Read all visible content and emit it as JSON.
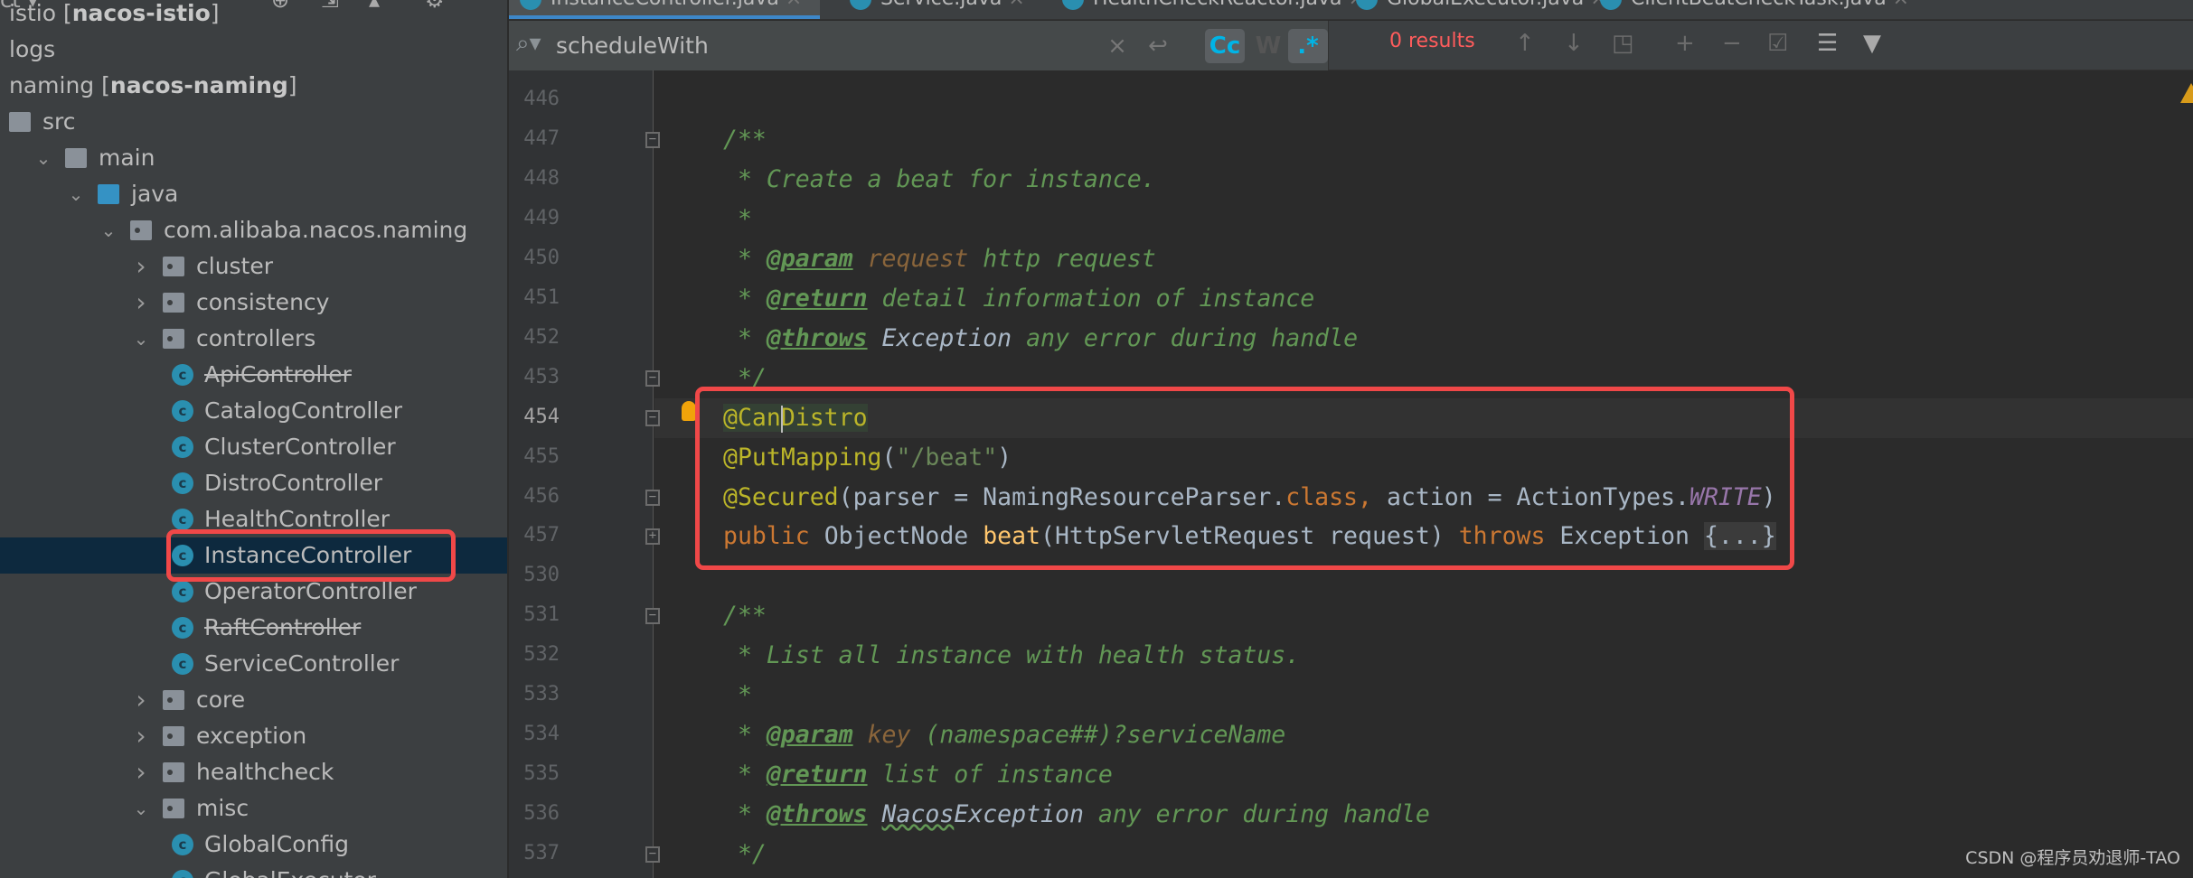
{
  "sidebar": {
    "toolbar_icons": [
      "globe-icon",
      "collapse-all-icon",
      "expand-icon",
      "gear-icon"
    ],
    "items": [
      {
        "label": "nacos-istio",
        "prefix": "istio ",
        "module": "nacos-istio",
        "depth": 0,
        "kind": "module",
        "cut": true
      },
      {
        "label": "logs",
        "depth": 0,
        "kind": "none"
      },
      {
        "label": "naming",
        "module": "nacos-naming",
        "depth": 0,
        "kind": "module"
      },
      {
        "label": "src",
        "depth": 0,
        "kind": "folder"
      },
      {
        "label": "main",
        "depth": 1,
        "kind": "folder",
        "expanded": true
      },
      {
        "label": "java",
        "depth": 2,
        "kind": "folder-blue",
        "expanded": true
      },
      {
        "label": "com.alibaba.nacos.naming",
        "depth": 3,
        "kind": "package",
        "expanded": true
      },
      {
        "label": "cluster",
        "depth": 4,
        "kind": "package",
        "expanded": false
      },
      {
        "label": "consistency",
        "depth": 4,
        "kind": "package",
        "expanded": false
      },
      {
        "label": "controllers",
        "depth": 4,
        "kind": "package",
        "expanded": true
      },
      {
        "label": "ApiController",
        "depth": 5,
        "kind": "class",
        "deprecated": true
      },
      {
        "label": "CatalogController",
        "depth": 5,
        "kind": "class"
      },
      {
        "label": "ClusterController",
        "depth": 5,
        "kind": "class"
      },
      {
        "label": "DistroController",
        "depth": 5,
        "kind": "class"
      },
      {
        "label": "HealthController",
        "depth": 5,
        "kind": "class"
      },
      {
        "label": "InstanceController",
        "depth": 5,
        "kind": "class",
        "selected": true
      },
      {
        "label": "OperatorController",
        "depth": 5,
        "kind": "class"
      },
      {
        "label": "RaftController",
        "depth": 5,
        "kind": "class",
        "deprecated": true
      },
      {
        "label": "ServiceController",
        "depth": 5,
        "kind": "class"
      },
      {
        "label": "core",
        "depth": 4,
        "kind": "package",
        "expanded": false
      },
      {
        "label": "exception",
        "depth": 4,
        "kind": "package",
        "expanded": false
      },
      {
        "label": "healthcheck",
        "depth": 4,
        "kind": "package",
        "expanded": false
      },
      {
        "label": "misc",
        "depth": 4,
        "kind": "package",
        "expanded": true
      },
      {
        "label": "GlobalConfig",
        "depth": 5,
        "kind": "class"
      },
      {
        "label": "GlobalExecutor",
        "depth": 5,
        "kind": "class"
      }
    ]
  },
  "tabs": [
    {
      "label": "InstanceController.java",
      "active": true
    },
    {
      "label": "Service.java"
    },
    {
      "label": "HealthCheckReactor.java"
    },
    {
      "label": "GlobalExecutor.java"
    },
    {
      "label": "ClientBeatCheckTask.java"
    }
  ],
  "search": {
    "value": "scheduleWith",
    "clear_icon": "×",
    "replace_icon": "↩",
    "match_case_label": "Cc",
    "words_label": "W",
    "regex_label": ".*",
    "results": "0 results",
    "results_color": "#ff5c5c"
  },
  "editor": {
    "current_line": "454",
    "lines": [
      {
        "n": "446",
        "tokens": []
      },
      {
        "n": "447",
        "fold": "open",
        "tokens": [
          [
            "/**",
            "c"
          ]
        ]
      },
      {
        "n": "448",
        "tokens": [
          [
            " * Create a beat for instance.",
            "c"
          ]
        ]
      },
      {
        "n": "449",
        "tokens": [
          [
            " *",
            "c"
          ]
        ]
      },
      {
        "n": "450",
        "tokens": [
          [
            " * ",
            "c"
          ],
          [
            "@param",
            "tag"
          ],
          [
            " ",
            "c"
          ],
          [
            "request",
            "param"
          ],
          [
            " http request",
            "c"
          ]
        ]
      },
      {
        "n": "451",
        "tokens": [
          [
            " * ",
            "c"
          ],
          [
            "@return",
            "tag"
          ],
          [
            " detail information of instance",
            "c"
          ]
        ]
      },
      {
        "n": "452",
        "tokens": [
          [
            " * ",
            "c"
          ],
          [
            "@throws",
            "tag"
          ],
          [
            " ",
            "c"
          ],
          [
            "Exception",
            "ref"
          ],
          [
            " any error during handle",
            "c"
          ]
        ]
      },
      {
        "n": "453",
        "fold": "close",
        "tokens": [
          [
            " */",
            "c"
          ]
        ]
      },
      {
        "n": "454",
        "fold": "open",
        "tokens": [
          [
            "@CanDistro",
            "annhl"
          ]
        ]
      },
      {
        "n": "455",
        "tokens": [
          [
            "@PutMapping",
            "ann"
          ],
          [
            "(",
            ""
          ],
          [
            "\"/beat\"",
            "str"
          ],
          [
            ")",
            ""
          ]
        ]
      },
      {
        "n": "456",
        "fold": "close",
        "tokens": [
          [
            "@Secured",
            "ann"
          ],
          [
            "(parser = NamingResourceParser.",
            ""
          ],
          [
            "class",
            "kw"
          ],
          [
            ", ",
            "kw"
          ],
          [
            "action = ActionTypes.",
            ""
          ],
          [
            "WRITE",
            "const"
          ],
          [
            ")",
            ""
          ]
        ]
      },
      {
        "n": "457",
        "fold": "plus",
        "tokens": [
          [
            "public ",
            "kw"
          ],
          [
            "ObjectNode ",
            ""
          ],
          [
            "beat",
            "fn"
          ],
          [
            "(HttpServletRequest request) ",
            ""
          ],
          [
            "throws ",
            "kw"
          ],
          [
            "Exception ",
            ""
          ],
          [
            "{...}",
            "fold"
          ]
        ]
      },
      {
        "n": "530",
        "tokens": []
      },
      {
        "n": "531",
        "fold": "open",
        "tokens": [
          [
            "/**",
            "c"
          ]
        ]
      },
      {
        "n": "532",
        "tokens": [
          [
            " * List all instance with health status.",
            "c"
          ]
        ]
      },
      {
        "n": "533",
        "tokens": [
          [
            " *",
            "c"
          ]
        ]
      },
      {
        "n": "534",
        "tokens": [
          [
            " * ",
            "c"
          ],
          [
            "@param",
            "tag"
          ],
          [
            " ",
            "c"
          ],
          [
            "key",
            "param"
          ],
          [
            " (namespace##)?serviceName",
            "c"
          ]
        ]
      },
      {
        "n": "535",
        "tokens": [
          [
            " * ",
            "c"
          ],
          [
            "@return",
            "tag"
          ],
          [
            " list of instance",
            "c"
          ]
        ]
      },
      {
        "n": "536",
        "tokens": [
          [
            " * ",
            "c"
          ],
          [
            "@throws",
            "tag"
          ],
          [
            " ",
            "c"
          ],
          [
            "Nacos",
            "refw"
          ],
          [
            "Exception",
            "ref"
          ],
          [
            " any error during handle",
            "c"
          ]
        ]
      },
      {
        "n": "537",
        "fold": "close",
        "tokens": [
          [
            " */",
            "c"
          ]
        ]
      }
    ]
  },
  "highlight_color": "#f04848",
  "watermark": "CSDN @程序员劝退师-TAO"
}
